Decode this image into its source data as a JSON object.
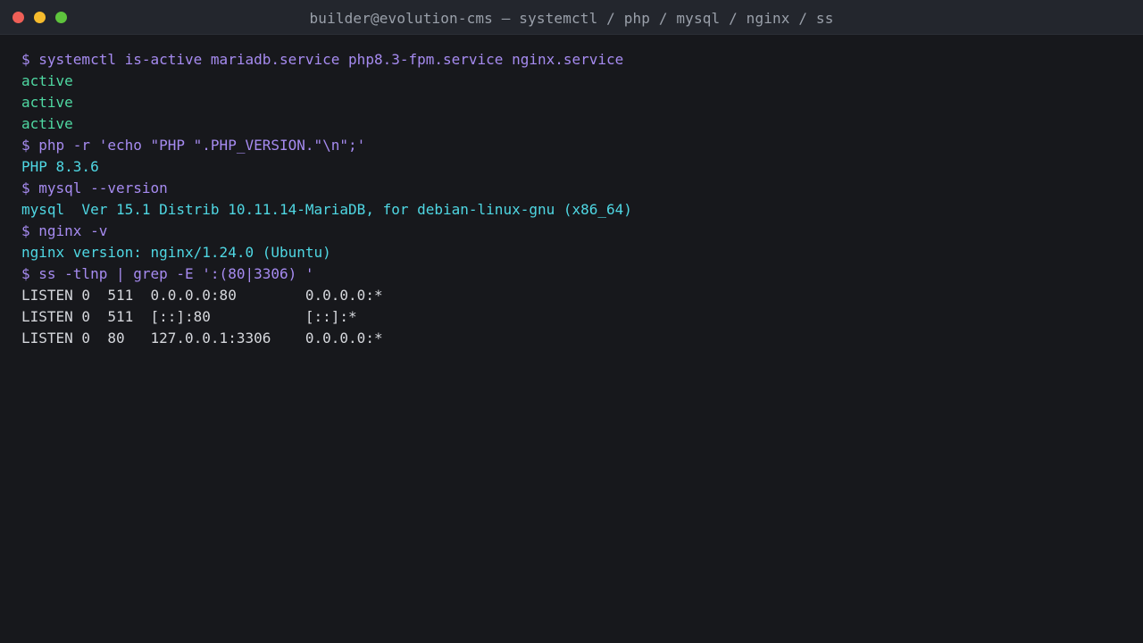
{
  "window": {
    "title": "builder@evolution-cms — systemctl / php / mysql / nginx / ss",
    "colors": {
      "background": "#17181c",
      "titlebar": "#23262d",
      "command": "#a68bf0",
      "status_ok": "#4fd8a2",
      "info_output": "#4fd7e3",
      "plain_output": "#d5d7dc"
    }
  },
  "terminal": {
    "lines": [
      "$ systemctl is-active mariadb.service php8.3-fpm.service nginx.service",
      "active",
      "active",
      "active",
      "$ php -r 'echo \"PHP \".PHP_VERSION.\"\\n\";'",
      "PHP 8.3.6",
      "$ mysql --version",
      "mysql  Ver 15.1 Distrib 10.11.14-MariaDB, for debian-linux-gnu (x86_64)",
      "$ nginx -v",
      "nginx version: nginx/1.24.0 (Ubuntu)",
      "$ ss -tlnp | grep -E ':(80|3306) '",
      "LISTEN 0  511  0.0.0.0:80        0.0.0.0:*",
      "LISTEN 0  511  [::]:80           [::]:*",
      "LISTEN 0  80   127.0.0.1:3306    0.0.0.0:*"
    ]
  }
}
